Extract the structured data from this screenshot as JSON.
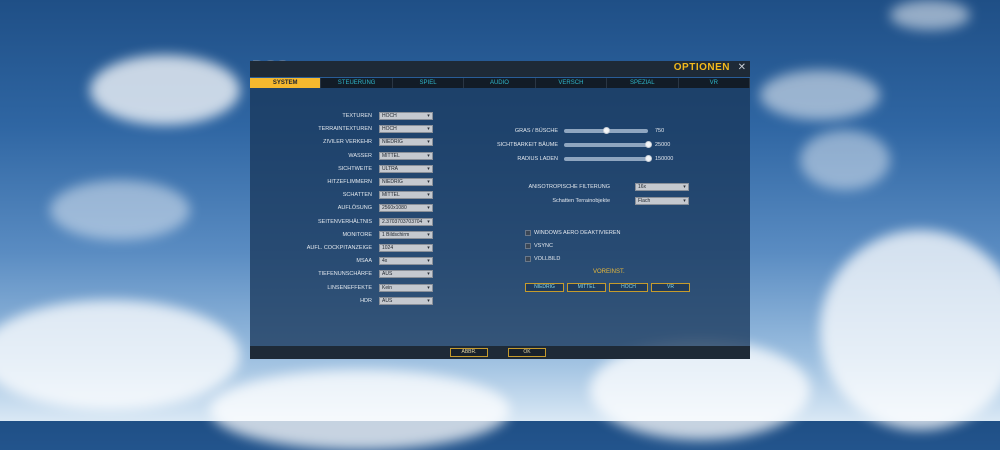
{
  "window": {
    "title": "OPTIONEN",
    "close_icon": "close-icon"
  },
  "tabs": [
    {
      "label": "SYSTEM",
      "active": true
    },
    {
      "label": "STEUERUNG",
      "active": false
    },
    {
      "label": "SPIEL",
      "active": false
    },
    {
      "label": "AUDIO",
      "active": false
    },
    {
      "label": "VERSCH",
      "active": false
    },
    {
      "label": "SPEZIAL",
      "active": false
    },
    {
      "label": "VR",
      "active": false
    }
  ],
  "left_settings": [
    {
      "label": "TEXTUREN",
      "value": "HOCH"
    },
    {
      "label": "TERRAINTEXTUREN",
      "value": "HOCH"
    },
    {
      "label": "ZIVILER VERKEHR",
      "value": "NIEDRIG"
    },
    {
      "label": "WASSER",
      "value": "MITTEL"
    },
    {
      "label": "SICHTWEITE",
      "value": "ULTRA"
    },
    {
      "label": "HITZEFLIMMERN",
      "value": "NIEDRIG"
    },
    {
      "label": "SCHATTEN",
      "value": "MITTEL"
    },
    {
      "label": "AUFLÖSUNG",
      "value": "2560x1080"
    },
    {
      "label": "SEITENVERHÄLTNIS",
      "value": "2.3703703703704"
    },
    {
      "label": "MONITORE",
      "value": "1 Bildschirm"
    },
    {
      "label": "AUFL. COCKPITANZEIGE",
      "value": "1024"
    },
    {
      "label": "MSAA",
      "value": "4x"
    },
    {
      "label": "TIEFENUNSCHÄRFE",
      "value": "AUS"
    },
    {
      "label": "LINSENEFFEKTE",
      "value": "Kein"
    },
    {
      "label": "HDR",
      "value": "AUS"
    }
  ],
  "sliders": [
    {
      "label": "GRAS / BÜSCHE",
      "value": "750",
      "fraction": 0.5
    },
    {
      "label": "SICHTBARKEIT BÄUME",
      "value": "25000",
      "fraction": 1.0
    },
    {
      "label": "RADIUS LADEN",
      "value": "150000",
      "fraction": 1.0
    }
  ],
  "right_dropdowns": [
    {
      "label": "ANISOTROPISCHE FILTERUNG",
      "value": "16x"
    },
    {
      "label": "Schatten Terrainobjekte",
      "value": "Flach"
    }
  ],
  "checkboxes": [
    {
      "label": "WINDOWS AERO DEAKTIVIEREN",
      "checked": false
    },
    {
      "label": "VSYNC",
      "checked": false
    },
    {
      "label": "VOLLBILD",
      "checked": false
    }
  ],
  "presets": {
    "title": "VOREINST.",
    "buttons": [
      "NIEDRIG",
      "MITTEL",
      "HOCH",
      "VR"
    ]
  },
  "footer": {
    "cancel_label": "ABBR.",
    "ok_label": "OK"
  },
  "colors": {
    "accent": "#f4b82e",
    "tab_text": "#2fb5c8",
    "panel": "#1a385c"
  }
}
